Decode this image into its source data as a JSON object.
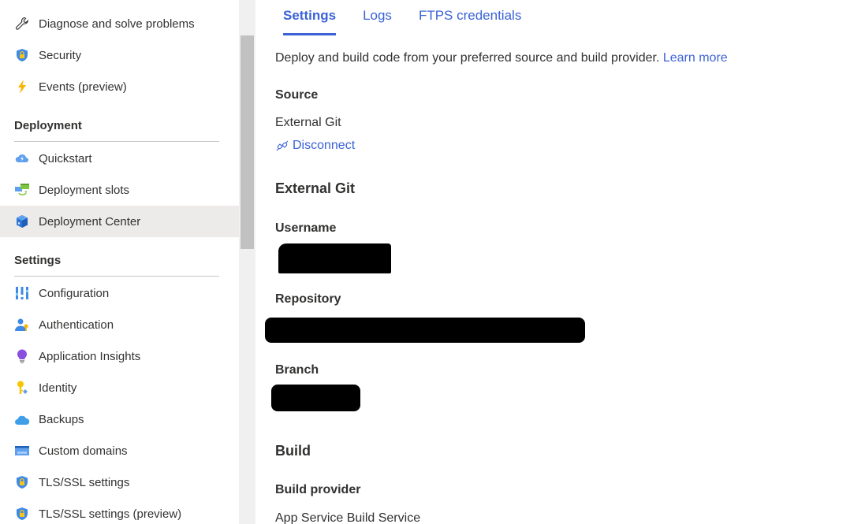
{
  "sidebar": {
    "items_top": [
      {
        "label": "Diagnose and solve problems",
        "icon": "wrench-icon"
      },
      {
        "label": "Security",
        "icon": "shield-lock-icon"
      },
      {
        "label": "Events (preview)",
        "icon": "lightning-icon"
      }
    ],
    "sections": [
      {
        "title": "Deployment",
        "items": [
          {
            "label": "Quickstart",
            "icon": "cloud-lightning-icon"
          },
          {
            "label": "Deployment slots",
            "icon": "deployment-slots-icon"
          },
          {
            "label": "Deployment Center",
            "icon": "cube-icon",
            "active": true
          }
        ]
      },
      {
        "title": "Settings",
        "items": [
          {
            "label": "Configuration",
            "icon": "config-bars-icon"
          },
          {
            "label": "Authentication",
            "icon": "user-key-icon"
          },
          {
            "label": "Application Insights",
            "icon": "lightbulb-icon"
          },
          {
            "label": "Identity",
            "icon": "key-icon"
          },
          {
            "label": "Backups",
            "icon": "cloud-backup-icon"
          },
          {
            "label": "Custom domains",
            "icon": "www-icon"
          },
          {
            "label": "TLS/SSL settings",
            "icon": "shield-lock-icon"
          },
          {
            "label": "TLS/SSL settings (preview)",
            "icon": "shield-lock-icon"
          }
        ]
      }
    ]
  },
  "main": {
    "tabs": [
      {
        "label": "Settings",
        "active": true
      },
      {
        "label": "Logs"
      },
      {
        "label": "FTPS credentials"
      }
    ],
    "description": "Deploy and build code from your preferred source and build provider.",
    "learn_more": "Learn more",
    "source": {
      "label": "Source",
      "value": "External Git",
      "disconnect_label": "Disconnect"
    },
    "external_git": {
      "heading": "External Git",
      "username_label": "Username",
      "username_value": "[redacted]",
      "repository_label": "Repository",
      "repository_value": "[redacted]",
      "branch_label": "Branch",
      "branch_value": "[redacted]"
    },
    "build": {
      "heading": "Build",
      "provider_label": "Build provider",
      "provider_value": "App Service Build Service"
    }
  },
  "colors": {
    "accent": "#3b63d6",
    "active_bg": "#edebe9",
    "text": "#323130"
  }
}
